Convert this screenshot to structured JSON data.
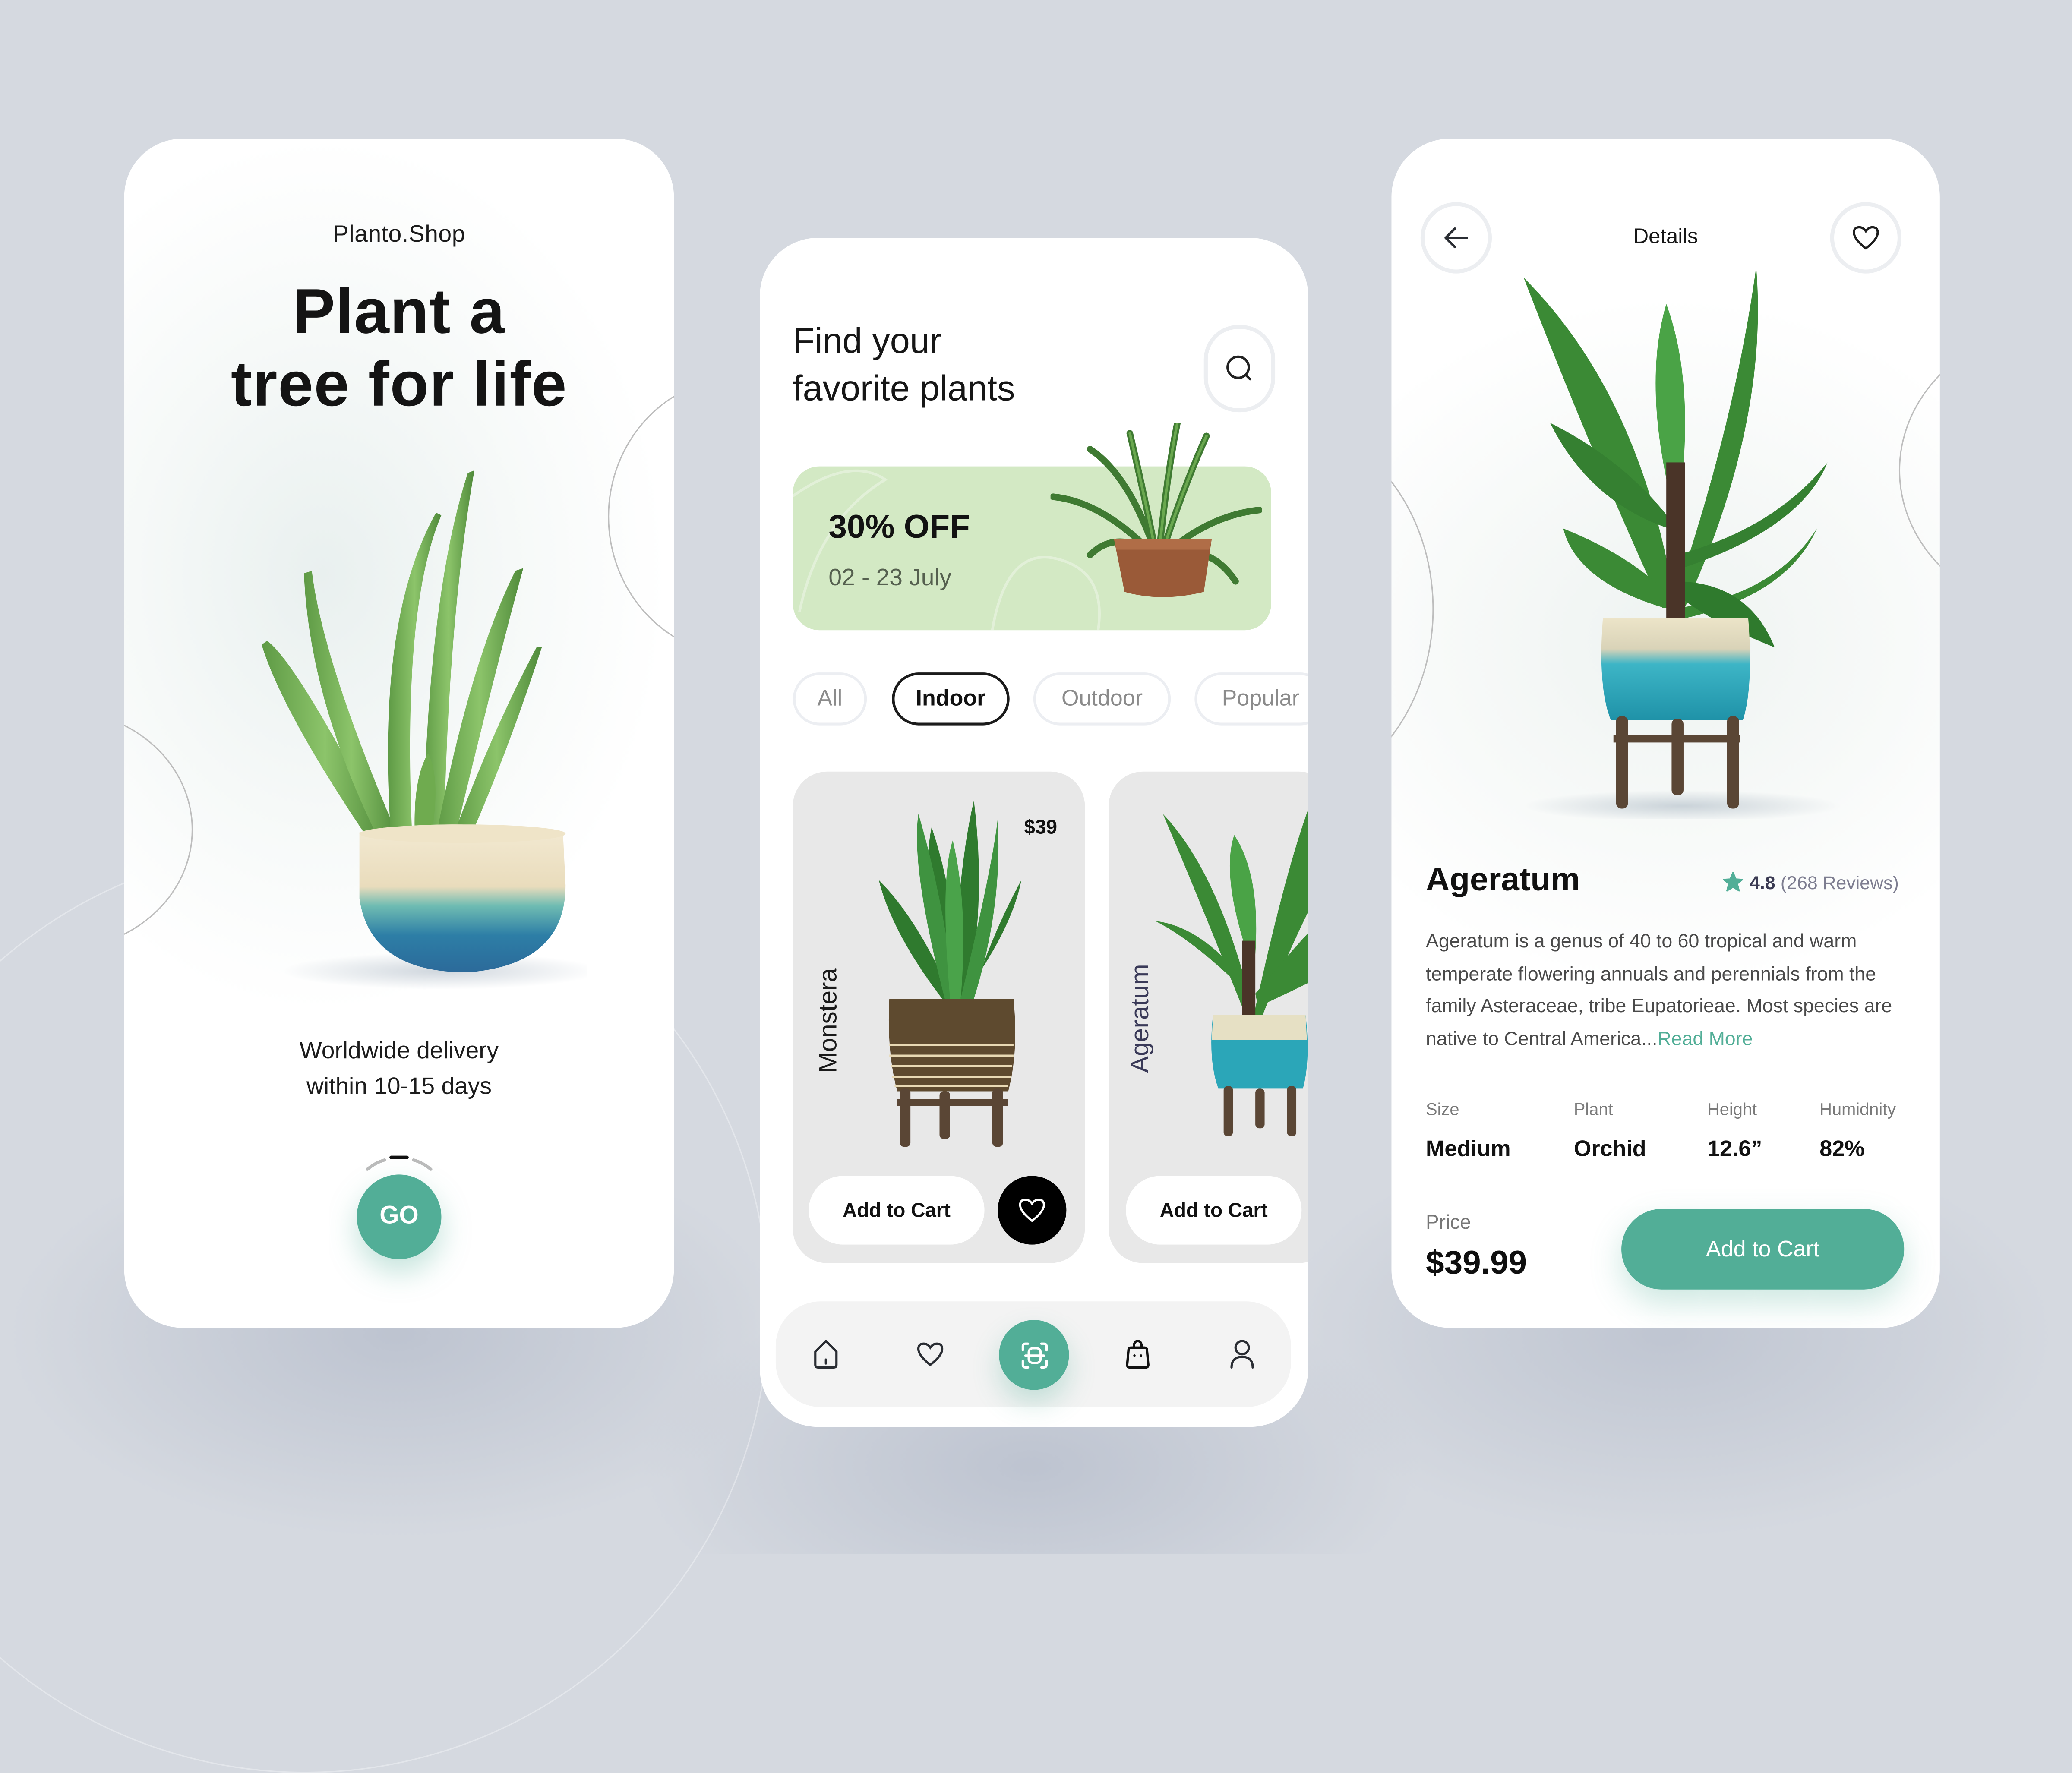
{
  "colors": {
    "accent": "#52ae97",
    "background": "#d5d9e0",
    "promo_bg": "#d3e9c4",
    "card_bg": "#e8e8e8"
  },
  "onboarding": {
    "brand": "Planto.Shop",
    "headline_line1": "Plant a",
    "headline_line2": "tree for life",
    "delivery_line1": "Worldwide  delivery",
    "delivery_line2": "within 10-15 days",
    "go_label": "GO",
    "pager": {
      "count": 3,
      "active_index": 1
    }
  },
  "browse": {
    "title_line1": "Find your",
    "title_line2": "favorite plants",
    "search_icon": "search-icon",
    "promo": {
      "discount": "30% OFF",
      "dates": "02 - 23 July"
    },
    "categories": [
      {
        "label": "All",
        "active": false
      },
      {
        "label": "Indoor",
        "active": true
      },
      {
        "label": "Outdoor",
        "active": false
      },
      {
        "label": "Popular",
        "active": false
      }
    ],
    "products": [
      {
        "name": "Monstera",
        "price": "$39",
        "cta": "Add to Cart"
      },
      {
        "name": "Ageratum",
        "price": "",
        "cta": "Add to Cart"
      }
    ],
    "nav": [
      {
        "icon": "home-icon"
      },
      {
        "icon": "heart-icon"
      },
      {
        "icon": "scan-icon",
        "active": true
      },
      {
        "icon": "bag-icon"
      },
      {
        "icon": "user-icon"
      }
    ]
  },
  "details": {
    "header_title": "Details",
    "name": "Ageratum",
    "rating": "4.8",
    "reviews": "(268 Reviews)",
    "description": "Ageratum is a genus of 40 to 60 tropical and warm temperate flowering annuals and perennials from the family Asteraceae, tribe Eupatorieae. Most species are native to Central America...",
    "read_more": "Read More",
    "specs": [
      {
        "label": "Size",
        "value": "Medium"
      },
      {
        "label": "Plant",
        "value": "Orchid"
      },
      {
        "label": "Height",
        "value": "12.6”"
      },
      {
        "label": "Humidnity",
        "value": "82%"
      }
    ],
    "price_label": "Price",
    "price": "$39.99",
    "cta": "Add to Cart"
  }
}
